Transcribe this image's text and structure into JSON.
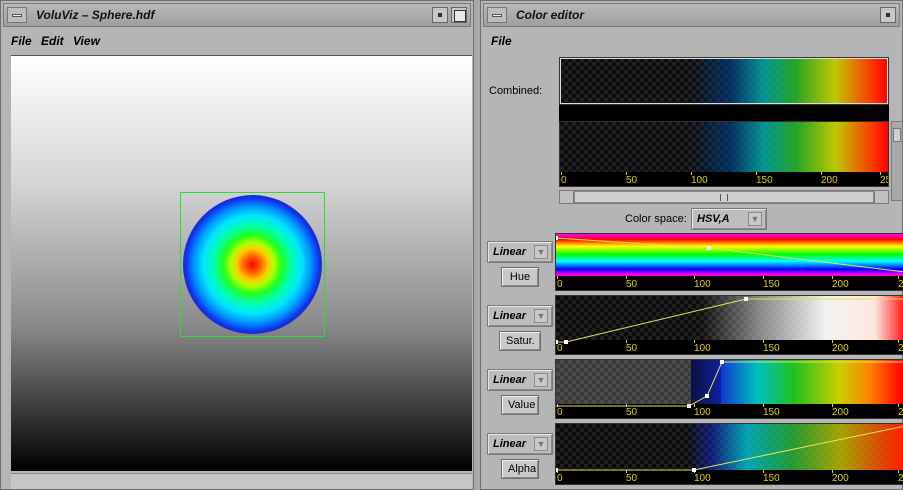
{
  "left_window": {
    "title": "VoluViz – Sphere.hdf",
    "menu": [
      "File",
      "Edit",
      "View"
    ]
  },
  "right_window": {
    "title": "Color editor",
    "menu": [
      "File"
    ],
    "combined_label": "Combined:",
    "color_space_label": "Color space:",
    "color_space_value": "HSV,A",
    "axis_ticks": [
      "0",
      "50",
      "100",
      "150",
      "200",
      "25"
    ],
    "channel_axis_ticks": [
      "0",
      "50",
      "100",
      "150",
      "200",
      "2"
    ],
    "channels": [
      {
        "mode": "Linear",
        "name": "Hue"
      },
      {
        "mode": "Linear",
        "name": "Satur."
      },
      {
        "mode": "Linear",
        "name": "Value"
      },
      {
        "mode": "Linear",
        "name": "Alpha"
      }
    ]
  },
  "colors": {
    "bbox": "#2edb2e",
    "curve": "#e6e05a",
    "tick_labels": "#e0d000"
  },
  "icons": [
    "window-menu-icon",
    "minimize-icon",
    "maximize-icon",
    "dropdown-arrow-icon"
  ]
}
